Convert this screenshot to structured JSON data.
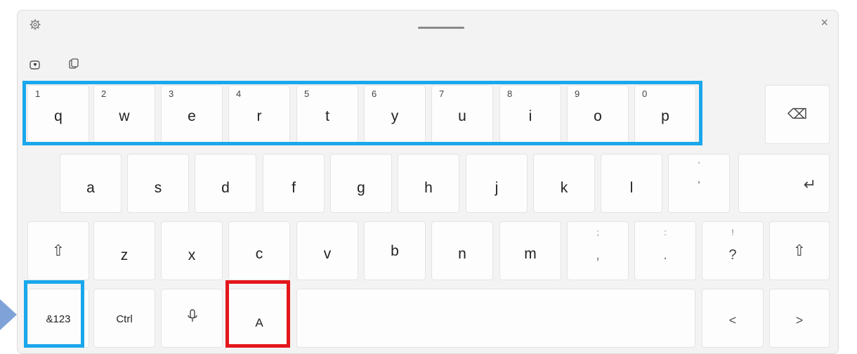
{
  "keyboard": {
    "close_symbol": "×",
    "row1": [
      {
        "hint": "1",
        "main": "q"
      },
      {
        "hint": "2",
        "main": "w"
      },
      {
        "hint": "3",
        "main": "e"
      },
      {
        "hint": "4",
        "main": "r"
      },
      {
        "hint": "5",
        "main": "t"
      },
      {
        "hint": "6",
        "main": "y"
      },
      {
        "hint": "7",
        "main": "u"
      },
      {
        "hint": "8",
        "main": "i"
      },
      {
        "hint": "9",
        "main": "o"
      },
      {
        "hint": "0",
        "main": "p"
      }
    ],
    "row2": [
      "a",
      "s",
      "d",
      "f",
      "g",
      "h",
      "j",
      "k",
      "l"
    ],
    "row2_punct": {
      "top": "'",
      "main": "'"
    },
    "row3": [
      "z",
      "x",
      "c",
      "v",
      "b",
      "n",
      "m"
    ],
    "row3_punct": [
      {
        "top": ";",
        "main": ","
      },
      {
        "top": ":",
        "main": "."
      },
      {
        "top": "!",
        "main": "?"
      }
    ],
    "row4": {
      "symbols_label": "&123",
      "ctrl_label": "Ctrl",
      "ime_label": "A",
      "left_arrow": "<",
      "right_arrow": ">"
    },
    "backspace_symbol": "⌫",
    "enter_symbol": "↵",
    "shift_symbol": "⇧"
  }
}
